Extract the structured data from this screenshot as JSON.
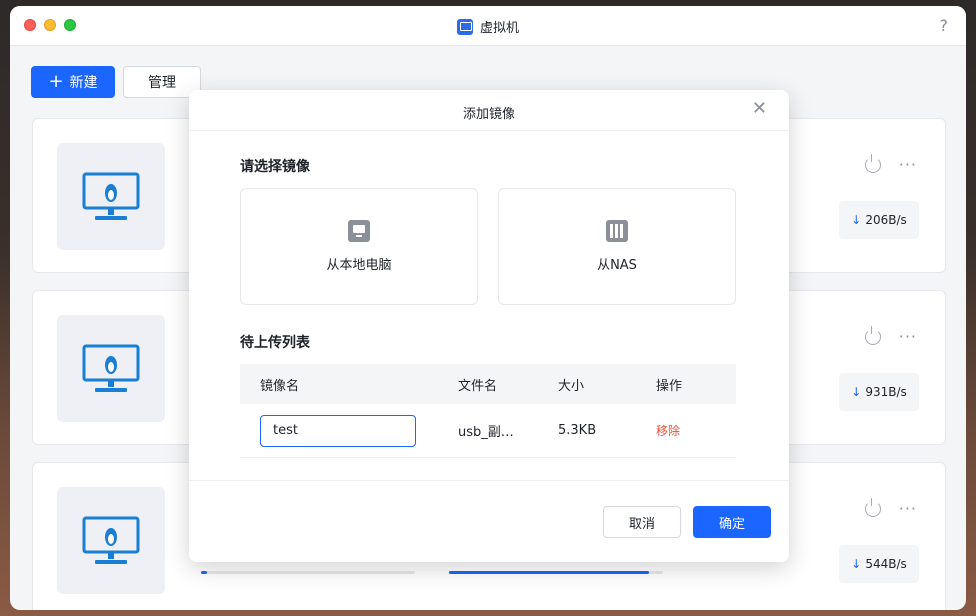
{
  "window": {
    "title": "虚拟机",
    "help_label": "?"
  },
  "toolbar": {
    "new_label": "新建",
    "manage_label": "管理"
  },
  "vm_cards": [
    {
      "download_rate": "206B/s"
    },
    {
      "download_rate": "931B/s"
    },
    {
      "download_rate": "544B/s"
    }
  ],
  "modal": {
    "title": "添加镜像",
    "select_label": "请选择镜像",
    "sources": [
      {
        "label": "从本地电脑",
        "icon": "computer-icon"
      },
      {
        "label": "从NAS",
        "icon": "nas-icon"
      }
    ],
    "queue_label": "待上传列表",
    "table": {
      "headers": [
        "镜像名",
        "文件名",
        "大小",
        "操作"
      ],
      "rows": [
        {
          "image_name": "test",
          "file_name": "usb_副…",
          "size": "5.3KB",
          "action": "移除"
        }
      ]
    },
    "cancel_label": "取消",
    "confirm_label": "确定"
  },
  "colors": {
    "accent": "#1a66ff",
    "danger": "#e5533d"
  }
}
